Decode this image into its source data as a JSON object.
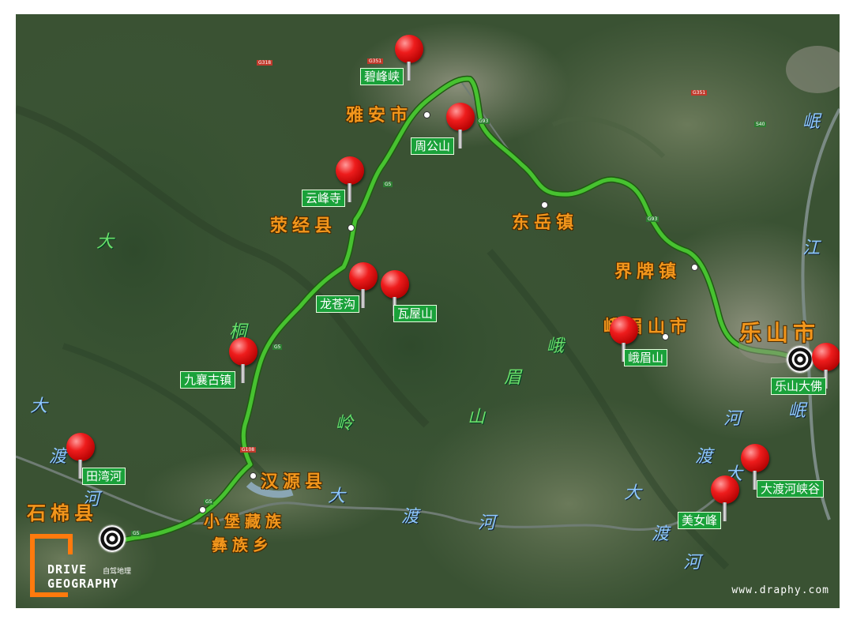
{
  "poi_labels": {
    "bifengxia": "碧峰峡",
    "zhougongshan": "周公山",
    "yunfengsi": "云峰寺",
    "longcanggou": "龙苍沟",
    "wawushan": "瓦屋山",
    "jiuxiang": "九襄古镇",
    "tianwanhe": "田湾河",
    "emeishan": "峨眉山",
    "leshan_dafo": "乐山大佛",
    "meinvfeng": "美女峰",
    "daduhe": "大渡河峡谷"
  },
  "cities": {
    "yaan": "雅安市",
    "yingjing": "荥经县",
    "dongyue": "东岳镇",
    "jiepai": "界牌镇",
    "emei_city": "峨眉山市",
    "leshan": "乐山市",
    "hanyuan": "汉源县",
    "xiaobao_1": "小堡藏族",
    "xiaobao_2": "彝族乡",
    "shimian": "石棉县"
  },
  "geo_text": {
    "tong": "桐",
    "ling": "岭",
    "da_left": "大",
    "du_left": "渡",
    "he_left": "河",
    "da_left2": "大",
    "e": "峨",
    "mei": "眉",
    "shan": "山",
    "da_mid": "大",
    "du_mid": "渡",
    "he_mid": "河",
    "da_bot": "大",
    "du_bot": "渡",
    "he_bot": "河",
    "he_right": "河",
    "du_right": "渡",
    "da_right": "大",
    "min1": "岷",
    "jiang": "江",
    "min2": "岷"
  },
  "road_shields": [
    "G351",
    "G318",
    "G5",
    "G93",
    "G108",
    "S40",
    "G351",
    "G93",
    "G5",
    "G5",
    "G5"
  ],
  "branding": {
    "line1": "DRIVE",
    "line2": "GEOGRAPHY",
    "cn": "自驾地理",
    "url": "www.draphy.com"
  },
  "colors": {
    "route": "#47c230",
    "pin": "#e61e1e",
    "label_bg": "#1aa13a",
    "city_text": "#f2961c",
    "logo_orange": "#ff7a0d"
  }
}
